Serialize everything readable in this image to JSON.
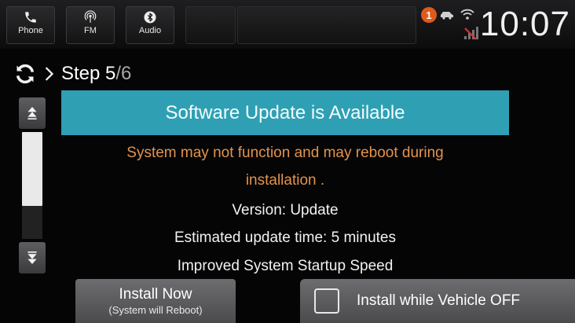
{
  "topbar": {
    "nav": [
      {
        "label": "Phone",
        "icon": "phone-icon"
      },
      {
        "label": "FM",
        "icon": "radio-icon"
      },
      {
        "label": "Audio",
        "icon": "bluetooth-icon"
      }
    ],
    "notification_count": "1",
    "clock": "10:07"
  },
  "breadcrumb": {
    "step_label": "Step 5",
    "step_total": "/6"
  },
  "content": {
    "banner": "Software Update is Available",
    "warning_line1": "System may not function and may reboot during",
    "warning_line2": "installation .",
    "version": "Version: Update",
    "estimate": "Estimated update time: 5 minutes",
    "improvement": "Improved System Startup Speed"
  },
  "actions": {
    "install_now": "Install Now",
    "install_now_sub": "(System will Reboot)",
    "install_off": "Install while Vehicle OFF",
    "install_off_checked": false
  },
  "colors": {
    "banner": "#2fa0b4",
    "warning": "#e3934e",
    "badge": "#e05a1a"
  }
}
